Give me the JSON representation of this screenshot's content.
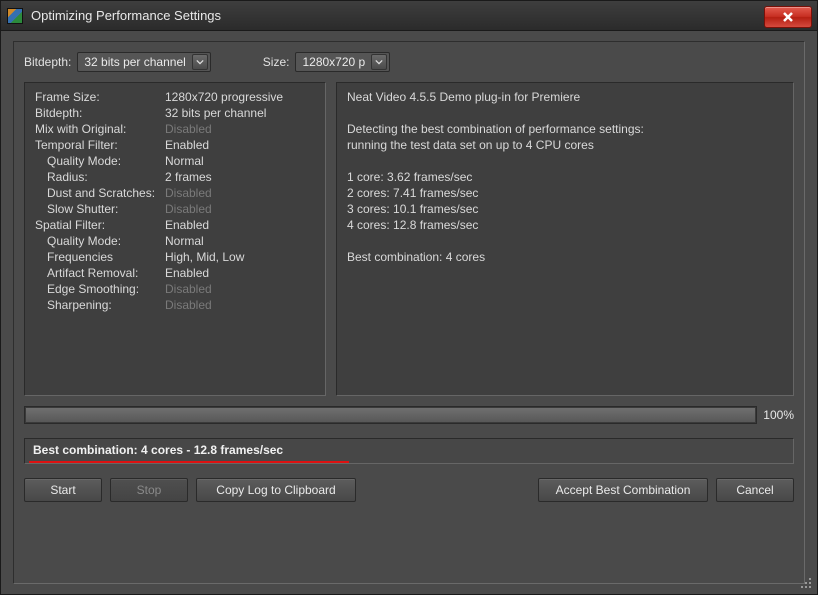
{
  "window": {
    "title": "Optimizing Performance Settings"
  },
  "toolbar": {
    "bitdepth_label": "Bitdepth:",
    "bitdepth_value": "32 bits per channel",
    "size_label": "Size:",
    "size_value": "1280x720 p"
  },
  "settings": [
    {
      "k": "Frame Size:",
      "v": "1280x720 progressive",
      "indent": false,
      "disabled": false
    },
    {
      "k": "Bitdepth:",
      "v": "32 bits per channel",
      "indent": false,
      "disabled": false
    },
    {
      "k": "Mix with Original:",
      "v": "Disabled",
      "indent": false,
      "disabled": true
    },
    {
      "k": "Temporal Filter:",
      "v": "Enabled",
      "indent": false,
      "disabled": false
    },
    {
      "k": "Quality Mode:",
      "v": "Normal",
      "indent": true,
      "disabled": false
    },
    {
      "k": "Radius:",
      "v": "2 frames",
      "indent": true,
      "disabled": false
    },
    {
      "k": "Dust and Scratches:",
      "v": "Disabled",
      "indent": true,
      "disabled": true
    },
    {
      "k": "Slow Shutter:",
      "v": "Disabled",
      "indent": true,
      "disabled": true
    },
    {
      "k": "Spatial Filter:",
      "v": "Enabled",
      "indent": false,
      "disabled": false
    },
    {
      "k": "Quality Mode:",
      "v": "Normal",
      "indent": true,
      "disabled": false
    },
    {
      "k": "Frequencies",
      "v": "High, Mid, Low",
      "indent": true,
      "disabled": false
    },
    {
      "k": "Artifact Removal:",
      "v": "Enabled",
      "indent": true,
      "disabled": false
    },
    {
      "k": "Edge Smoothing:",
      "v": "Disabled",
      "indent": true,
      "disabled": true
    },
    {
      "k": "Sharpening:",
      "v": "Disabled",
      "indent": true,
      "disabled": true
    }
  ],
  "log": [
    "Neat Video 4.5.5 Demo plug-in for Premiere",
    "",
    "Detecting the best combination of performance settings:",
    "running the test data set on up to 4 CPU cores",
    "",
    "1 core: 3.62 frames/sec",
    "2 cores: 7.41 frames/sec",
    "3 cores: 10.1 frames/sec",
    "4 cores: 12.8 frames/sec",
    "",
    "Best combination: 4 cores"
  ],
  "progress": {
    "percent": "100%"
  },
  "best": {
    "text": "Best combination: 4 cores - 12.8 frames/sec"
  },
  "buttons": {
    "start": "Start",
    "stop": "Stop",
    "copy": "Copy Log to Clipboard",
    "accept": "Accept Best Combination",
    "cancel": "Cancel"
  }
}
